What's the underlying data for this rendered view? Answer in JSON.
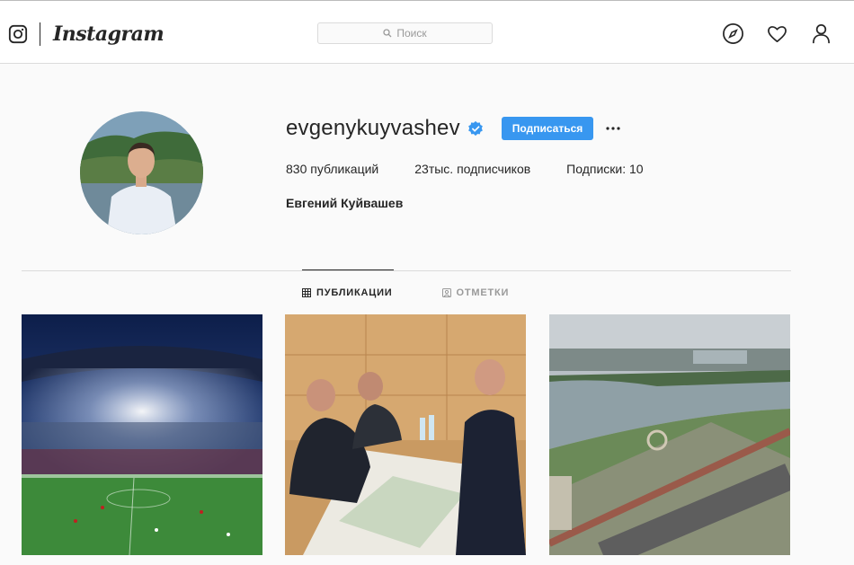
{
  "header": {
    "logo_text": "Instagram",
    "search_placeholder": "Поиск",
    "icons": [
      "instagram-glyph-icon",
      "search-icon",
      "compass-icon",
      "heart-icon",
      "user-icon"
    ]
  },
  "profile": {
    "username": "evgenykuyvashev",
    "verified": true,
    "follow_label": "Подписаться",
    "stats": {
      "posts_value": "830",
      "posts_label": "публикаций",
      "followers_value": "23тыс.",
      "followers_label": "подписчиков",
      "following_label": "Подписки:",
      "following_value": "10"
    },
    "full_name": "Евгений Куйвашев"
  },
  "tabs": [
    {
      "label": "ПУБЛИКАЦИИ",
      "active": true
    },
    {
      "label": "ОТМЕТКИ",
      "active": false
    }
  ],
  "colors": {
    "accent": "#3897f0",
    "text": "#262626",
    "muted": "#999999",
    "border": "#dbdbdb"
  }
}
